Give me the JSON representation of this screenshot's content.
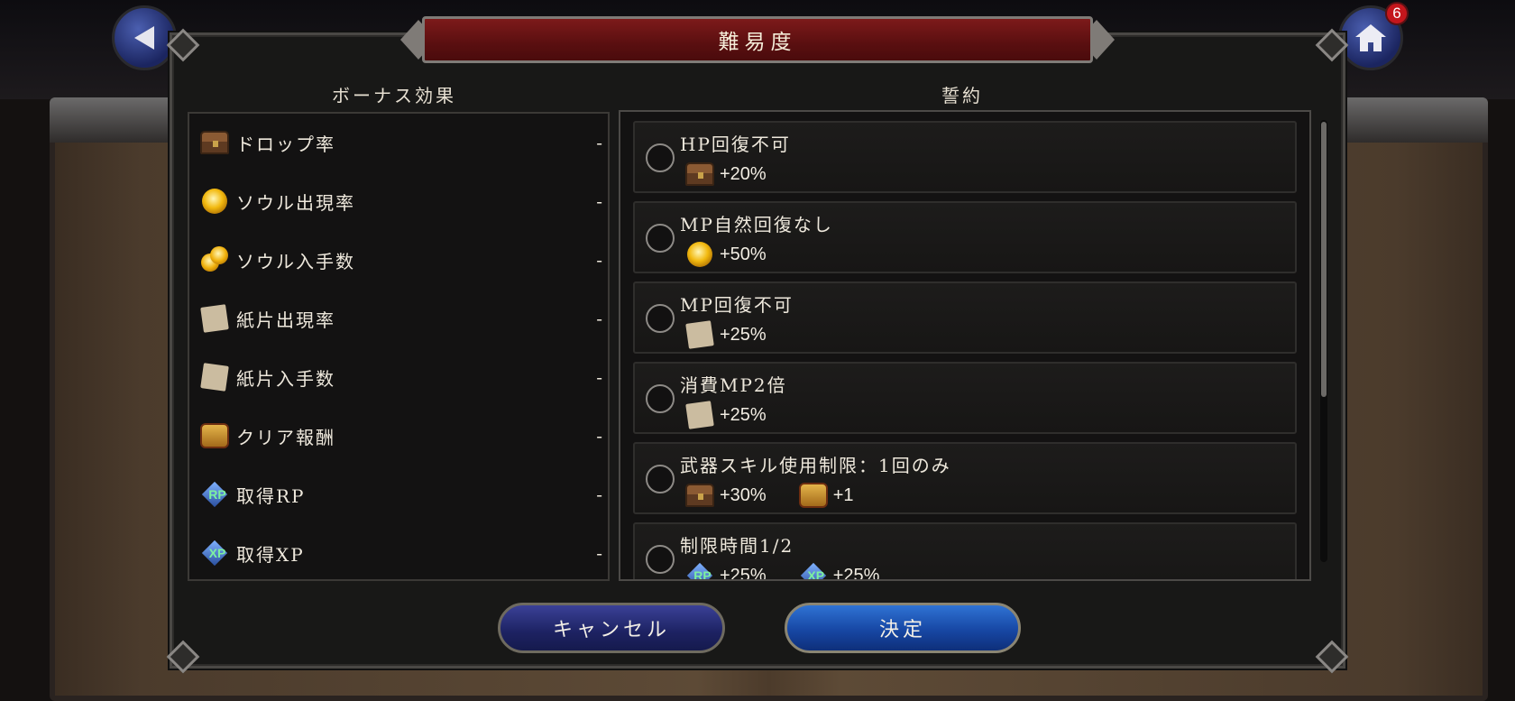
{
  "header": {
    "title": "難易度",
    "home_badge": "6"
  },
  "bonus": {
    "heading": "ボーナス効果",
    "items": [
      {
        "label": "ドロップ率",
        "value": "-",
        "icon": "treasure-chest-icon"
      },
      {
        "label": "ソウル出現率",
        "value": "-",
        "icon": "soul-orb-icon"
      },
      {
        "label": "ソウル入手数",
        "value": "-",
        "icon": "soul-orbs-icon"
      },
      {
        "label": "紙片出現率",
        "value": "-",
        "icon": "paper-scrap-icon"
      },
      {
        "label": "紙片入手数",
        "value": "-",
        "icon": "paper-scraps-icon"
      },
      {
        "label": "クリア報酬",
        "value": "-",
        "icon": "golden-chest-icon"
      },
      {
        "label": "取得RP",
        "value": "-",
        "icon": "rp-diamond-icon"
      },
      {
        "label": "取得XP",
        "value": "-",
        "icon": "xp-diamond-icon"
      }
    ]
  },
  "vows": {
    "heading": "誓約",
    "items": [
      {
        "title": "HP回復不可",
        "effects": [
          {
            "icon": "treasure-chest-icon",
            "value": "+20%"
          }
        ]
      },
      {
        "title": "MP自然回復なし",
        "effects": [
          {
            "icon": "soul-orb-icon",
            "value": "+50%"
          }
        ]
      },
      {
        "title": "MP回復不可",
        "effects": [
          {
            "icon": "paper-scrap-icon",
            "value": "+25%"
          }
        ]
      },
      {
        "title": "消費MP2倍",
        "effects": [
          {
            "icon": "paper-scrap-icon",
            "value": "+25%"
          }
        ]
      },
      {
        "title": "武器スキル使用制限：1回のみ",
        "effects": [
          {
            "icon": "treasure-chest-icon",
            "value": "+30%"
          },
          {
            "icon": "golden-chest-icon",
            "value": "+1"
          }
        ]
      },
      {
        "title": "制限時間1/2",
        "effects": [
          {
            "icon": "rp-diamond-icon",
            "value": "+25%"
          },
          {
            "icon": "xp-diamond-icon",
            "value": "+25%"
          }
        ]
      }
    ]
  },
  "buttons": {
    "cancel": "キャンセル",
    "confirm": "決定"
  },
  "icon_text": {
    "rp": "RP",
    "xp": "XP"
  },
  "colors": {
    "title_bar": "#6b1414",
    "cancel_button": "#262b78",
    "confirm_button": "#1d55b8"
  }
}
